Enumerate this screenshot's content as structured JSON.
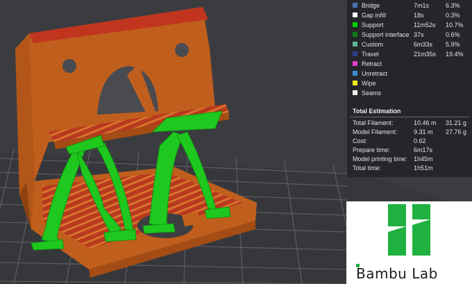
{
  "legend": [
    {
      "label": "Bridge",
      "time": "7m1s",
      "percent": "6.3%",
      "color": "#4a73b0"
    },
    {
      "label": "Gap infill",
      "time": "18s",
      "percent": "0.3%",
      "color": "#ffffff"
    },
    {
      "label": "Support",
      "time": "11m52s",
      "percent": "10.7%",
      "color": "#00d000"
    },
    {
      "label": "Support interface",
      "time": "37s",
      "percent": "0.6%",
      "color": "#0d7d1a"
    },
    {
      "label": "Custom",
      "time": "6m33s",
      "percent": "5.9%",
      "color": "#5fb390"
    },
    {
      "label": "Travel",
      "time": "21m35s",
      "percent": "19.4%",
      "color": "#2b3f8c"
    },
    {
      "label": "Retract",
      "time": "",
      "percent": "",
      "color": "#e33ec8"
    },
    {
      "label": "Unretract",
      "time": "",
      "percent": "",
      "color": "#3a8fd1"
    },
    {
      "label": "Wipe",
      "time": "",
      "percent": "",
      "color": "#f1e91c"
    },
    {
      "label": "Seams",
      "time": "",
      "percent": "",
      "color": "#ededed"
    }
  ],
  "estimation": {
    "title": "Total Estimation",
    "rows": [
      {
        "label": "Total Filament:",
        "value1": "10.46 m",
        "value2": "31.21 g"
      },
      {
        "label": "Model Filament:",
        "value1": "9.31 m",
        "value2": "27.76 g"
      },
      {
        "label": "Cost:",
        "value1": "0.62",
        "value2": ""
      },
      {
        "label": "Prepare time:",
        "value1": "6m17s",
        "value2": ""
      },
      {
        "label": "Model printing time:",
        "value1": "1h45m",
        "value2": ""
      },
      {
        "label": "Total time:",
        "value1": "1h51m",
        "value2": ""
      }
    ]
  },
  "brand": {
    "name": "Bambu Lab",
    "logo_color": "#1fb140"
  },
  "colors": {
    "model_orange": "#c4611e",
    "top_red": "#c1351f",
    "support_green": "#1ec81e",
    "bed_grid": "#5b5c60"
  }
}
